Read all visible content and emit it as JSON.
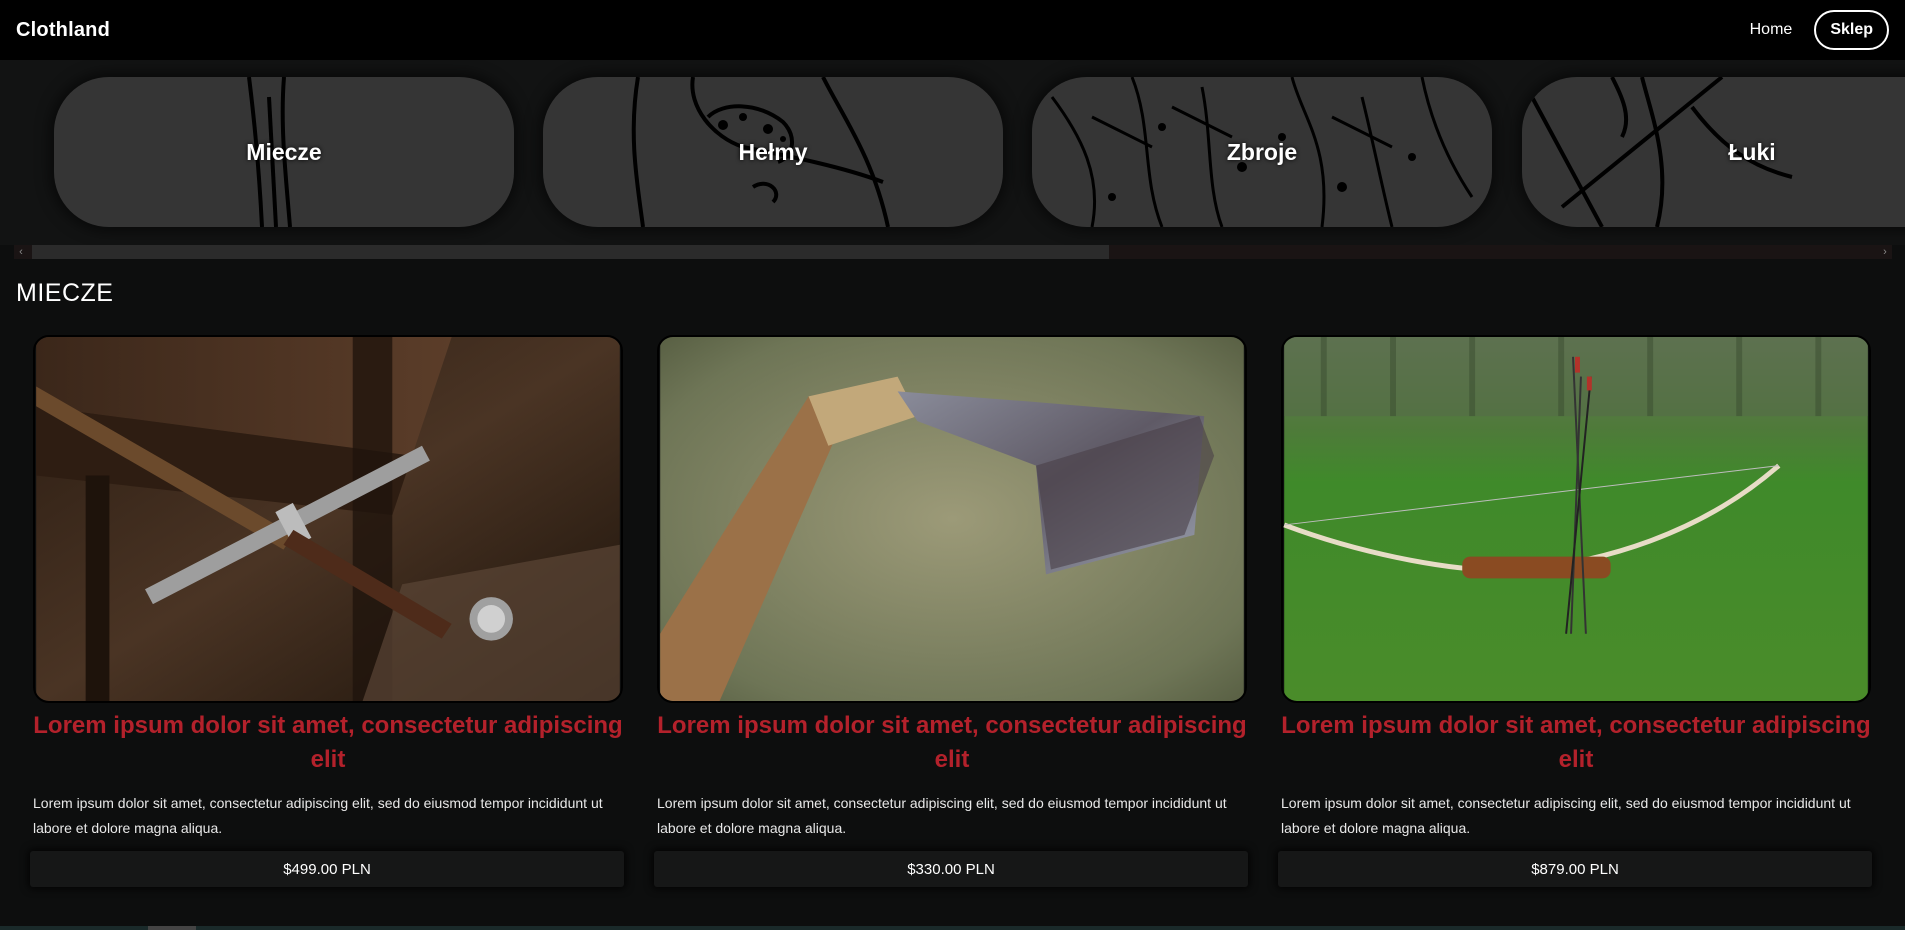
{
  "navbar": {
    "brand": "Clothland",
    "home_label": "Home",
    "shop_label": "Sklep"
  },
  "categories": [
    {
      "label": "Miecze"
    },
    {
      "label": "Hełmy"
    },
    {
      "label": "Zbroje"
    },
    {
      "label": "Łuki"
    }
  ],
  "scrollbar": {
    "left_arrow": "‹",
    "right_arrow": "›"
  },
  "section": {
    "title": "MIECZE"
  },
  "products": [
    {
      "image": "sword-photo",
      "title": "Lorem ipsum dolor sit amet, consectetur adipiscing elit",
      "description": "Lorem ipsum dolor sit amet, consectetur adipiscing elit, sed do eiusmod tempor incididunt ut labore et dolore magna aliqua.",
      "price": "$499.00 PLN"
    },
    {
      "image": "axe-photo",
      "title": "Lorem ipsum dolor sit amet, consectetur adipiscing elit",
      "description": "Lorem ipsum dolor sit amet, consectetur adipiscing elit, sed do eiusmod tempor incididunt ut labore et dolore magna aliqua.",
      "price": "$330.00 PLN"
    },
    {
      "image": "bow-photo",
      "title": "Lorem ipsum dolor sit amet, consectetur adipiscing elit",
      "description": "Lorem ipsum dolor sit amet, consectetur adipiscing elit, sed do eiusmod tempor incididunt ut labore et dolore magna aliqua.",
      "price": "$879.00 PLN"
    }
  ],
  "colors": {
    "accent": "#b3212b",
    "background": "#0d0e0e",
    "navbar": "#000000",
    "category_card": "#353535"
  }
}
